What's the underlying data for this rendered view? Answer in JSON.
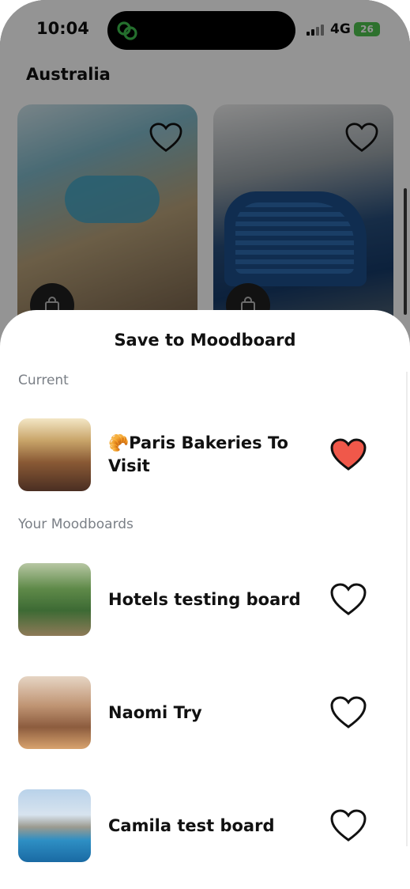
{
  "status_bar": {
    "time": "10:04",
    "network": "4G",
    "battery": "26"
  },
  "background": {
    "section_title": "Australia",
    "cards": [
      {
        "favorite": false
      },
      {
        "favorite": false
      }
    ]
  },
  "sheet": {
    "title": "Save to Moodboard",
    "current_label": "Current",
    "your_label": "Your Moodboards",
    "current": {
      "emoji": "🥐",
      "name": "Paris Bakeries To Visit",
      "saved": true
    },
    "boards": [
      {
        "name": "Hotels testing board",
        "saved": false
      },
      {
        "name": "Naomi Try",
        "saved": false
      },
      {
        "name": "Camila test board",
        "saved": false
      }
    ]
  },
  "colors": {
    "heart_filled": "#f0584a",
    "battery": "#4fc34f",
    "muted_text": "#7a7f86"
  },
  "icons": [
    "app-logo-icon",
    "signal-icon",
    "battery-icon",
    "heart-outline-icon",
    "heart-filled-icon",
    "shopping-bag-icon"
  ]
}
